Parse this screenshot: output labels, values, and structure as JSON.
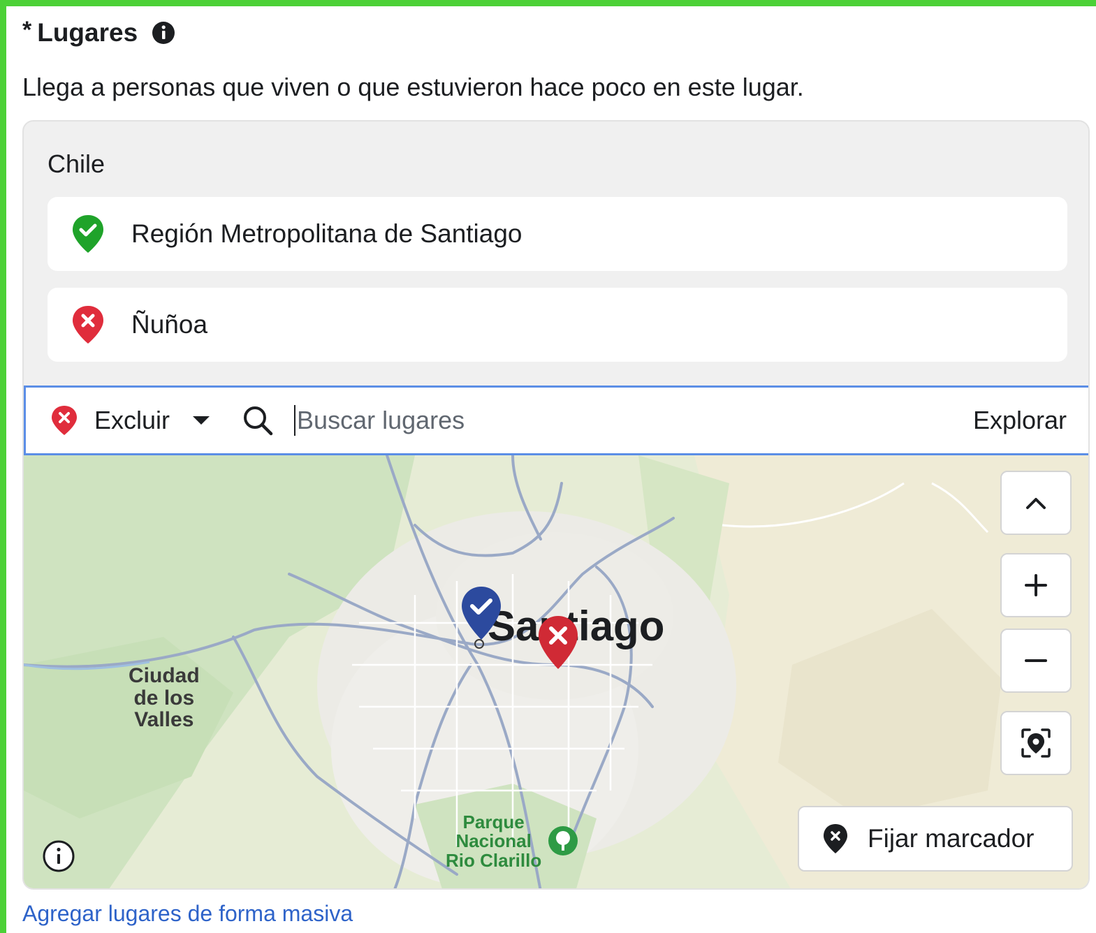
{
  "section": {
    "required_marker": "*",
    "title": "Lugares",
    "description": "Llega a personas que viven o que estuvieron hace poco en este lugar."
  },
  "locations": {
    "country": "Chile",
    "items": [
      {
        "label": "Región Metropolitana de Santiago",
        "status": "included",
        "color": "#1fa32a"
      },
      {
        "label": "Ñuñoa",
        "status": "excluded",
        "color": "#e02d3c"
      }
    ]
  },
  "search": {
    "mode_label": "Excluir",
    "placeholder": "Buscar lugares",
    "value": "",
    "explore_label": "Explorar"
  },
  "map": {
    "city_label": "Santiago",
    "town_label_lines": [
      "Ciudad",
      "de los",
      "Valles"
    ],
    "park_label_lines": [
      "Parque",
      "Nacional",
      "Rio Clarillo"
    ],
    "include_marker_color": "#2c4a9e",
    "exclude_marker_color": "#d02a35",
    "controls": [
      "chevron-up-icon",
      "zoom-in-icon",
      "zoom-out-icon",
      "locate-icon"
    ],
    "pin_button_label": "Fijar marcador"
  },
  "footer": {
    "bulk_link": "Agregar lugares de forma masiva"
  },
  "colors": {
    "frame": "#4cd137",
    "link": "#2e63c9",
    "focus_border": "#5b8ee6"
  }
}
